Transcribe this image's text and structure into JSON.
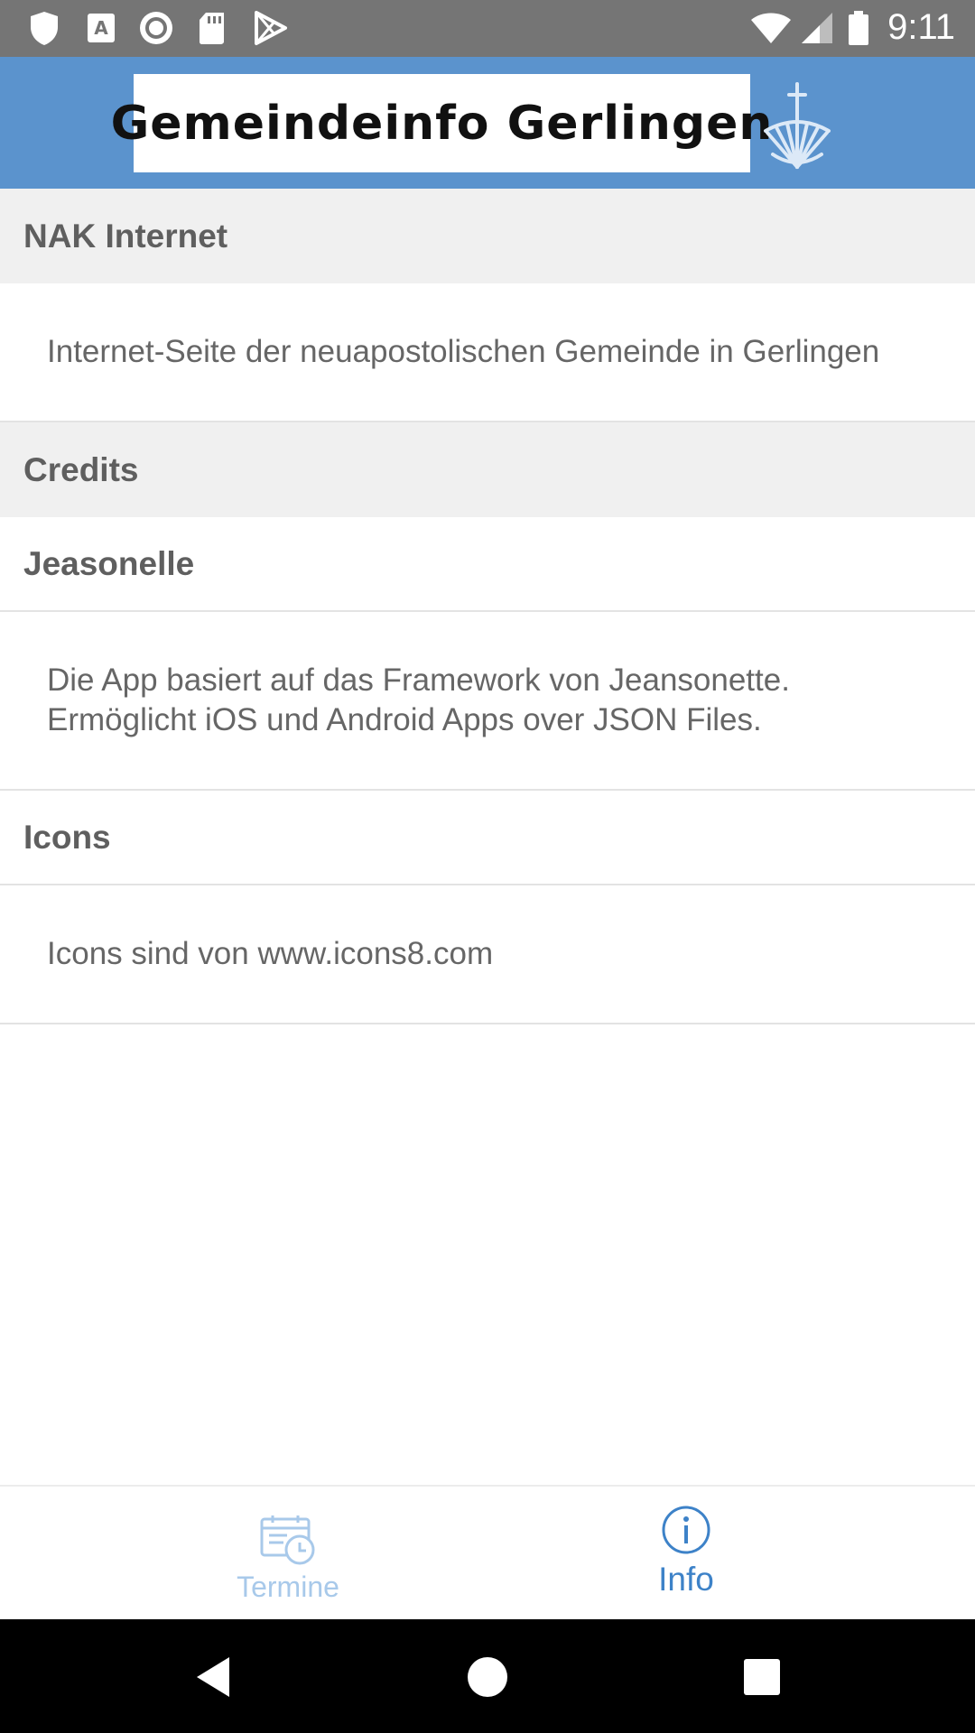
{
  "status_bar": {
    "time": "9:11",
    "icons": [
      "shield-icon",
      "font-download-icon",
      "record-icon",
      "sd-card-icon",
      "play-store-icon",
      "wifi-icon",
      "signal-icon",
      "battery-icon"
    ]
  },
  "header": {
    "title": "Gemeindeinfo Gerlingen",
    "logo_icon": "church-logo-icon",
    "background_color": "#5b93cd"
  },
  "sections": {
    "nak_internet": {
      "header": "NAK Internet",
      "text": "Internet-Seite der neuapostolischen Gemeinde in Gerlingen"
    },
    "credits": {
      "header": "Credits",
      "jeasonelle": {
        "title": "Jeasonelle",
        "text": "Die App basiert auf das Framework von Jeansonette.\nErmöglicht iOS und Android Apps over JSON Files."
      },
      "icons": {
        "title": "Icons",
        "text": "Icons sind von www.icons8.com"
      }
    }
  },
  "tabs": [
    {
      "label": "Termine",
      "icon": "calendar-clock-icon",
      "active": false
    },
    {
      "label": "Info",
      "icon": "info-icon",
      "active": true
    }
  ],
  "colors": {
    "accent": "#3d82c8",
    "inactive_tab": "#a8c9ea",
    "section_bg": "#f0f0f0"
  },
  "nav_bar": {
    "buttons": [
      "back-icon",
      "home-icon",
      "recents-icon"
    ]
  }
}
